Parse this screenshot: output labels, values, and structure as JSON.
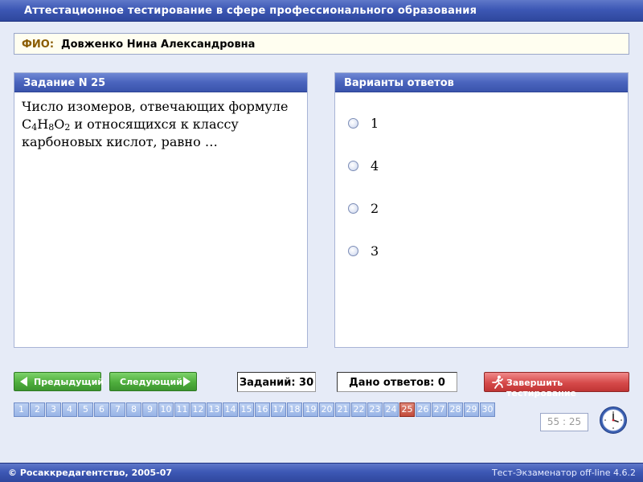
{
  "window": {
    "title": "Аттестационное тестирование в сфере профессионального образования"
  },
  "fio": {
    "label": "ФИО:",
    "name": "Довженко Нина Александровна"
  },
  "task": {
    "header": "Задание N 25",
    "question": {
      "part1": "Число изомеров, отвечающих формуле C",
      "sub1": "4",
      "part2": "H",
      "sub2": "8",
      "part3": "O",
      "sub3": "2",
      "part4": " и относящихся к классу карбоновых кислот, равно …"
    }
  },
  "answers": {
    "header": "Варианты ответов",
    "options": [
      "1",
      "4",
      "2",
      "3"
    ]
  },
  "toolbar": {
    "prev_label": "Предыдущий",
    "next_label": "Следующий",
    "tasks_count": "Заданий: 30",
    "answers_given": "Дано ответов: 0",
    "finish_label": "Завершить тестирование"
  },
  "pages": {
    "numbers": [
      "1",
      "2",
      "3",
      "4",
      "5",
      "6",
      "7",
      "8",
      "9",
      "10",
      "11",
      "12",
      "13",
      "14",
      "15",
      "16",
      "17",
      "18",
      "19",
      "20",
      "21",
      "22",
      "23",
      "24",
      "25",
      "26",
      "27",
      "28",
      "29",
      "30"
    ],
    "current": "25"
  },
  "timer": {
    "value": "55 : 25"
  },
  "footer": {
    "copyright": "© Росаккредагентство, 2005-07",
    "version": "Тест-Экзаменатор off-line 4.6.2"
  },
  "icons": {
    "prev": "arrow-left-icon",
    "next": "arrow-right-icon",
    "finish": "running-man-icon",
    "clock": "clock-icon"
  },
  "colors": {
    "title_bar": "#3d58b5",
    "nav_button": "#4fae3d",
    "finish_button": "#d64a4a",
    "current_page": "#c24a3a",
    "page_button": "#98b4e6",
    "fio_label": "#8a5c00"
  }
}
